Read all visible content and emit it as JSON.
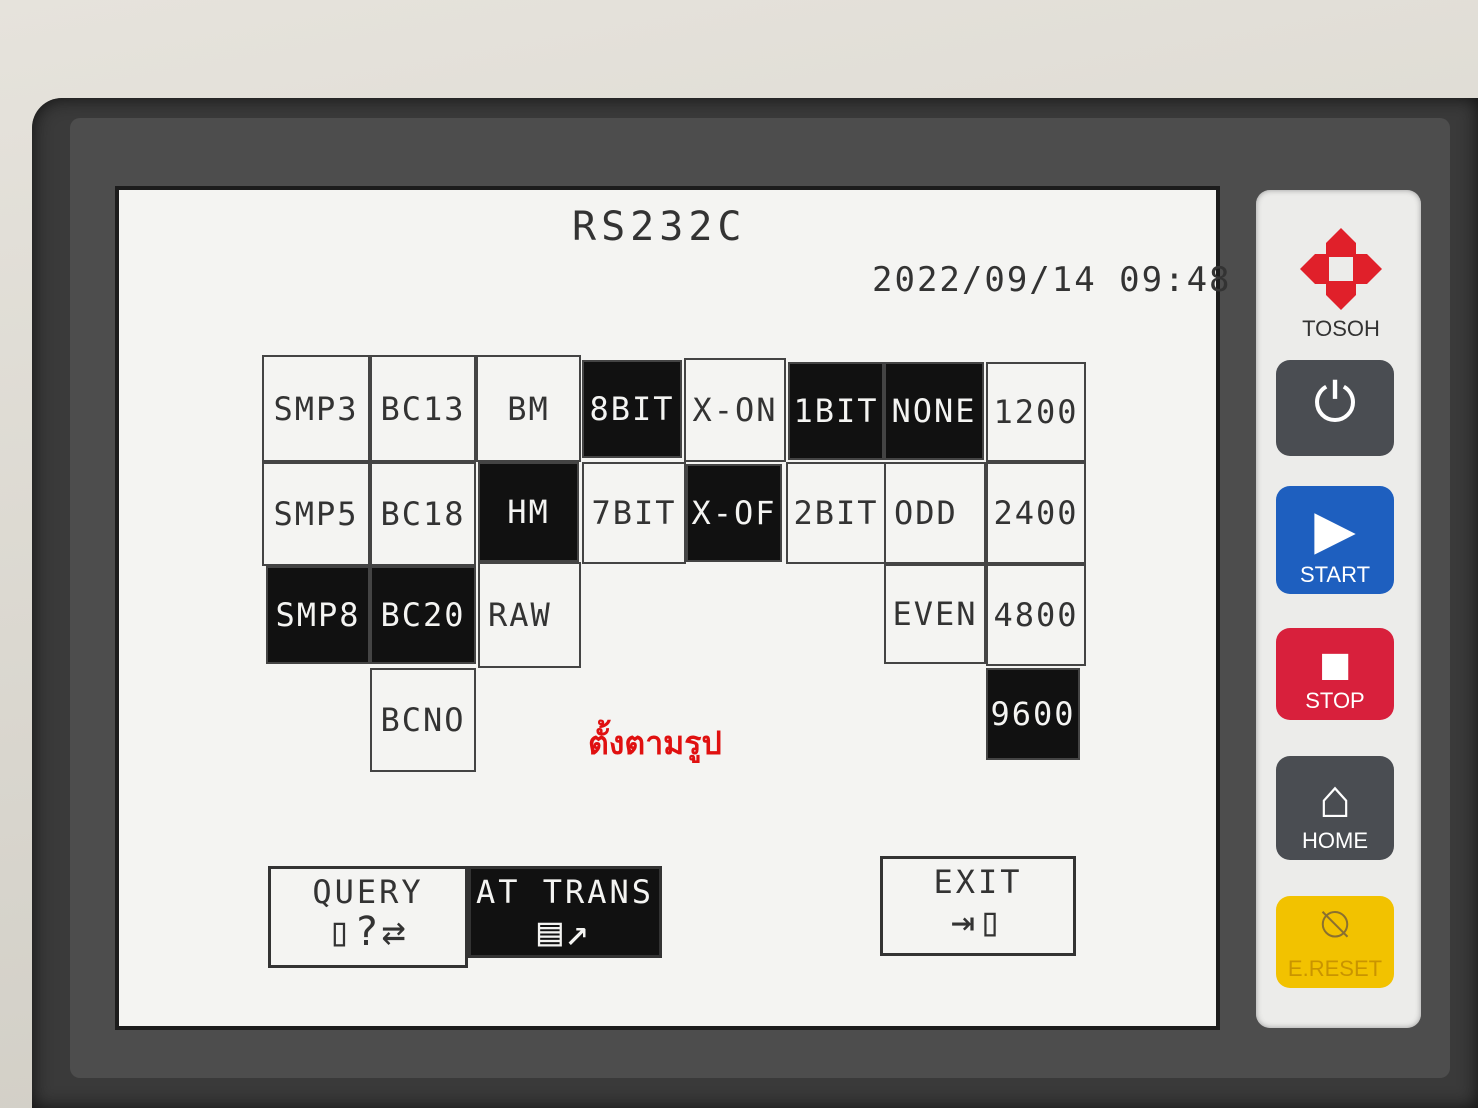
{
  "screen": {
    "title": "RS232C",
    "datetime": "2022/09/14 09:48"
  },
  "options": [
    {
      "label": "SMP3",
      "selected": false
    },
    {
      "label": "SMP5",
      "selected": false
    },
    {
      "label": "SMP8",
      "selected": true
    },
    {
      "label": "BC13",
      "selected": false
    },
    {
      "label": "BC18",
      "selected": false
    },
    {
      "label": "BC20",
      "selected": true
    },
    {
      "label": "BCNO",
      "selected": false
    },
    {
      "label": "BM",
      "selected": false
    },
    {
      "label": "HM",
      "selected": true
    },
    {
      "label": "RAW",
      "selected": false
    },
    {
      "label": "8BIT",
      "selected": true
    },
    {
      "label": "7BIT",
      "selected": false
    },
    {
      "label": "X-ON",
      "selected": false
    },
    {
      "label": "X-OF",
      "selected": true
    },
    {
      "label": "1BIT",
      "selected": true
    },
    {
      "label": "2BIT",
      "selected": false
    },
    {
      "label": "NONE",
      "selected": true
    },
    {
      "label": "ODD",
      "selected": false
    },
    {
      "label": "EVEN",
      "selected": false
    },
    {
      "label": "1200",
      "selected": false
    },
    {
      "label": "2400",
      "selected": false
    },
    {
      "label": "4800",
      "selected": false
    },
    {
      "label": "9600",
      "selected": true
    }
  ],
  "note": "ตั้งตามรูป",
  "actions": {
    "query": "QUERY",
    "at_trans": "AT TRANS",
    "exit": "EXIT"
  },
  "hardware": {
    "brand": "TOSOH",
    "start": "START",
    "stop": "STOP",
    "home": "HOME",
    "e_reset": "E.RESET",
    "colors": {
      "brand_red": "#e0202a",
      "start_blue": "#1e5fbf",
      "stop_red": "#d8203c",
      "home_gray": "#4a4d52",
      "e_reset_yellow": "#f2c200"
    }
  }
}
